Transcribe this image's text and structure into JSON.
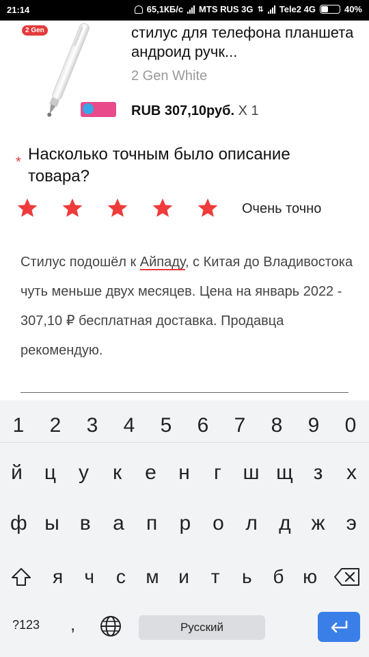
{
  "status_bar": {
    "time": "21:14",
    "speed": "65,1КБ/с",
    "carrier1": "MTS RUS 3G",
    "carrier2": "Tele2 4G",
    "battery": "40%"
  },
  "product": {
    "badge_gen": "2 Gen",
    "title": "стилус для телефона планшета андроид ручк...",
    "variant": "2 Gen White",
    "price": "RUB 307,10руб.",
    "quantity": "X 1"
  },
  "question": {
    "required_mark": "*",
    "text": "Насколько точным было описание товара?",
    "stars_filled": 5,
    "stars_total": 5,
    "rating_label": "Очень точно",
    "star_color": "#ef3b3b"
  },
  "review": {
    "before": "Стилус подошёл к ",
    "underlined": "Айпаду",
    "after": ", с Китая до Владивостока чуть меньше двух месяцев. Цена на январь 2022 - 307,10 ₽ бесплатная доставка. Продавца рекомендую."
  },
  "keyboard": {
    "number_row": [
      "1",
      "2",
      "3",
      "4",
      "5",
      "6",
      "7",
      "8",
      "9",
      "0"
    ],
    "row1": [
      "й",
      "ц",
      "у",
      "к",
      "е",
      "н",
      "г",
      "ш",
      "щ",
      "з",
      "х"
    ],
    "row2": [
      "ф",
      "ы",
      "в",
      "а",
      "п",
      "р",
      "о",
      "л",
      "д",
      "ж",
      "э"
    ],
    "row3": [
      "я",
      "ч",
      "с",
      "м",
      "и",
      "т",
      "ь",
      "б",
      "ю"
    ],
    "symbols_key": "?123",
    "comma_key": ",",
    "space_label": "Русский",
    "enter_color": "#3a7fe8"
  }
}
